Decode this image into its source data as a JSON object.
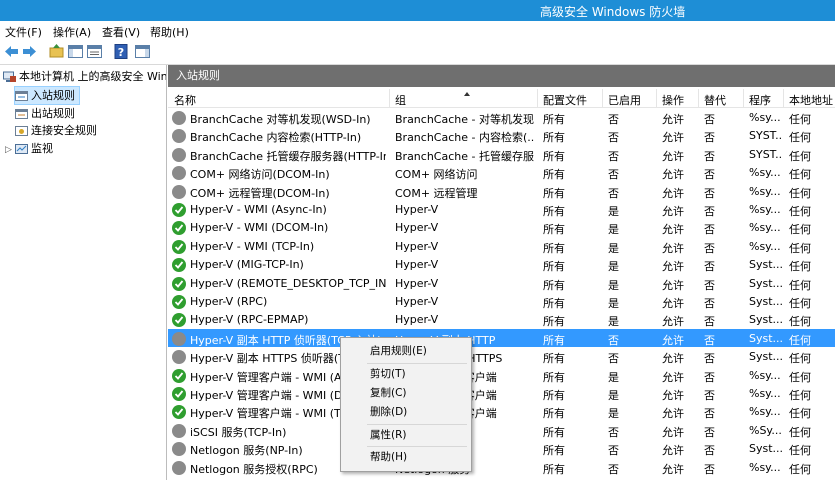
{
  "window": {
    "title": "高级安全 Windows 防火墙"
  },
  "menu": [
    "文件(F)",
    "操作(A)",
    "查看(V)",
    "帮助(H)"
  ],
  "toolbar": [
    "back-icon",
    "forward-icon",
    "up-folder-icon",
    "show-hide-tree-icon",
    "properties-icon",
    "help-icon",
    "show-hide-action-pane-icon"
  ],
  "tree": {
    "root": "本地计算机 上的高级安全 Wind",
    "items": [
      "入站规则",
      "出站规则",
      "连接安全规则",
      "监视"
    ]
  },
  "pane": {
    "title": "入站规则"
  },
  "columns": [
    "名称",
    "组",
    "配置文件",
    "已启用",
    "操作",
    "替代",
    "程序",
    "本地地址"
  ],
  "rows": [
    {
      "name": "BranchCache 对等机发现(WSD-In)",
      "group": "BranchCache - 对等机发现...",
      "profile": "所有",
      "enabled": "否",
      "action": "允许",
      "override": "否",
      "program": "%sy...",
      "local": "任何",
      "status": "off"
    },
    {
      "name": "BranchCache 内容检索(HTTP-In)",
      "group": "BranchCache - 内容检索(...",
      "profile": "所有",
      "enabled": "否",
      "action": "允许",
      "override": "否",
      "program": "SYST...",
      "local": "任何",
      "status": "off"
    },
    {
      "name": "BranchCache 托管缓存服务器(HTTP-In)",
      "group": "BranchCache - 托管缓存服...",
      "profile": "所有",
      "enabled": "否",
      "action": "允许",
      "override": "否",
      "program": "SYST...",
      "local": "任何",
      "status": "off"
    },
    {
      "name": "COM+ 网络访问(DCOM-In)",
      "group": "COM+ 网络访问",
      "profile": "所有",
      "enabled": "否",
      "action": "允许",
      "override": "否",
      "program": "%sy...",
      "local": "任何",
      "status": "off"
    },
    {
      "name": "COM+ 远程管理(DCOM-In)",
      "group": "COM+ 远程管理",
      "profile": "所有",
      "enabled": "否",
      "action": "允许",
      "override": "否",
      "program": "%sy...",
      "local": "任何",
      "status": "off"
    },
    {
      "name": "Hyper-V - WMI (Async-In)",
      "group": "Hyper-V",
      "profile": "所有",
      "enabled": "是",
      "action": "允许",
      "override": "否",
      "program": "%sy...",
      "local": "任何",
      "status": "on"
    },
    {
      "name": "Hyper-V - WMI (DCOM-In)",
      "group": "Hyper-V",
      "profile": "所有",
      "enabled": "是",
      "action": "允许",
      "override": "否",
      "program": "%sy...",
      "local": "任何",
      "status": "on"
    },
    {
      "name": "Hyper-V - WMI (TCP-In)",
      "group": "Hyper-V",
      "profile": "所有",
      "enabled": "是",
      "action": "允许",
      "override": "否",
      "program": "%sy...",
      "local": "任何",
      "status": "on"
    },
    {
      "name": "Hyper-V (MIG-TCP-In)",
      "group": "Hyper-V",
      "profile": "所有",
      "enabled": "是",
      "action": "允许",
      "override": "否",
      "program": "Syst...",
      "local": "任何",
      "status": "on"
    },
    {
      "name": "Hyper-V (REMOTE_DESKTOP_TCP_IN)",
      "group": "Hyper-V",
      "profile": "所有",
      "enabled": "是",
      "action": "允许",
      "override": "否",
      "program": "Syst...",
      "local": "任何",
      "status": "on"
    },
    {
      "name": "Hyper-V (RPC)",
      "group": "Hyper-V",
      "profile": "所有",
      "enabled": "是",
      "action": "允许",
      "override": "否",
      "program": "Syst...",
      "local": "任何",
      "status": "on"
    },
    {
      "name": "Hyper-V (RPC-EPMAP)",
      "group": "Hyper-V",
      "profile": "所有",
      "enabled": "是",
      "action": "允许",
      "override": "否",
      "program": "Syst...",
      "local": "任何",
      "status": "on"
    },
    {
      "name": "Hyper-V 副本 HTTP 侦听器(TCP-入站)",
      "group": "Hyper-V 副本 HTTP",
      "profile": "所有",
      "enabled": "否",
      "action": "允许",
      "override": "否",
      "program": "Syst...",
      "local": "任何",
      "status": "off",
      "selected": true
    },
    {
      "name": "Hyper-V 副本 HTTPS 侦听器(TCP-入站)",
      "group": "Hyper-V 副本 HTTPS",
      "profile": "所有",
      "enabled": "否",
      "action": "允许",
      "override": "否",
      "program": "Syst...",
      "local": "任何",
      "status": "off"
    },
    {
      "name": "Hyper-V 管理客户端 - WMI (Async-In)",
      "group": "Hyper-V 管理客户端",
      "profile": "所有",
      "enabled": "是",
      "action": "允许",
      "override": "否",
      "program": "%sy...",
      "local": "任何",
      "status": "on"
    },
    {
      "name": "Hyper-V 管理客户端 - WMI (DCOM-In)",
      "group": "Hyper-V 管理客户端",
      "profile": "所有",
      "enabled": "是",
      "action": "允许",
      "override": "否",
      "program": "%sy...",
      "local": "任何",
      "status": "on"
    },
    {
      "name": "Hyper-V 管理客户端 - WMI (TCP-In)",
      "group": "Hyper-V 管理客户端",
      "profile": "所有",
      "enabled": "是",
      "action": "允许",
      "override": "否",
      "program": "%sy...",
      "local": "任何",
      "status": "on"
    },
    {
      "name": "iSCSI 服务(TCP-In)",
      "group": "iSCSI 服务",
      "profile": "所有",
      "enabled": "否",
      "action": "允许",
      "override": "否",
      "program": "%Sy...",
      "local": "任何",
      "status": "off"
    },
    {
      "name": "Netlogon 服务(NP-In)",
      "group": "Netlogon 服务",
      "profile": "所有",
      "enabled": "否",
      "action": "允许",
      "override": "否",
      "program": "Syst...",
      "local": "任何",
      "status": "off"
    },
    {
      "name": "Netlogon 服务授权(RPC)",
      "group": "Netlogon 服务",
      "profile": "所有",
      "enabled": "否",
      "action": "允许",
      "override": "否",
      "program": "%sy...",
      "local": "任何",
      "status": "off"
    }
  ],
  "context_menu": {
    "items": [
      "启用规则(E)",
      "剪切(T)",
      "复制(C)",
      "删除(D)",
      "属性(R)",
      "帮助(H)"
    ]
  }
}
